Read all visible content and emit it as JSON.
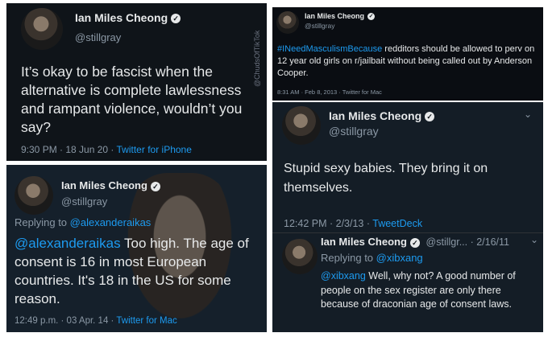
{
  "p1": {
    "name": "Ian Miles Cheong",
    "handle": "@stillgray",
    "text": "It’s okay to be fascist when the alternative is complete lawlessness and rampant violence, wouldn’t you say?",
    "meta_time": "9:30 PM · 18 Jun 20 · ",
    "meta_client": "Twitter for iPhone",
    "watermark": "@ChudsOfTikTok"
  },
  "p2": {
    "name": "Ian Miles Cheong",
    "handle": "@stillgray",
    "replying_label": "Replying to ",
    "replying_to": "@alexanderaikas",
    "mention": "@alexanderaikas",
    "text": " Too high. The age of consent is 16 in most European countries. It's 18 in the US for some reason.",
    "meta_time": "12:49 p.m. · 03 Apr. 14 · ",
    "meta_client": "Twitter for Mac"
  },
  "p3": {
    "name": "Ian Miles Cheong",
    "handle": "@stillgray",
    "hashtag": "#INeedMasculismBecause",
    "text": " redditors should be allowed to perv on 12 year old girls on r/jailbait without being called out by Anderson Cooper.",
    "meta": "8:31 AM · Feb 8, 2013 · Twitter for Mac"
  },
  "p4": {
    "name": "Ian Miles Cheong",
    "handle": "@stillgray",
    "text": "Stupid sexy babies. They bring it on themselves.",
    "meta_time": "12:42 PM · 2/3/13 · ",
    "meta_client": "TweetDeck",
    "reply": {
      "name": "Ian Miles Cheong",
      "handle_date": "@stillgr... · 2/16/11",
      "replying_label": "Replying to ",
      "replying_to": "@xibxang",
      "mention": "@xibxang",
      "text": " Well, why not? A good number of people on the sex register are only there because of draconian age of consent laws."
    }
  },
  "icons": {
    "verified": "✓",
    "chevron": "⌄"
  }
}
